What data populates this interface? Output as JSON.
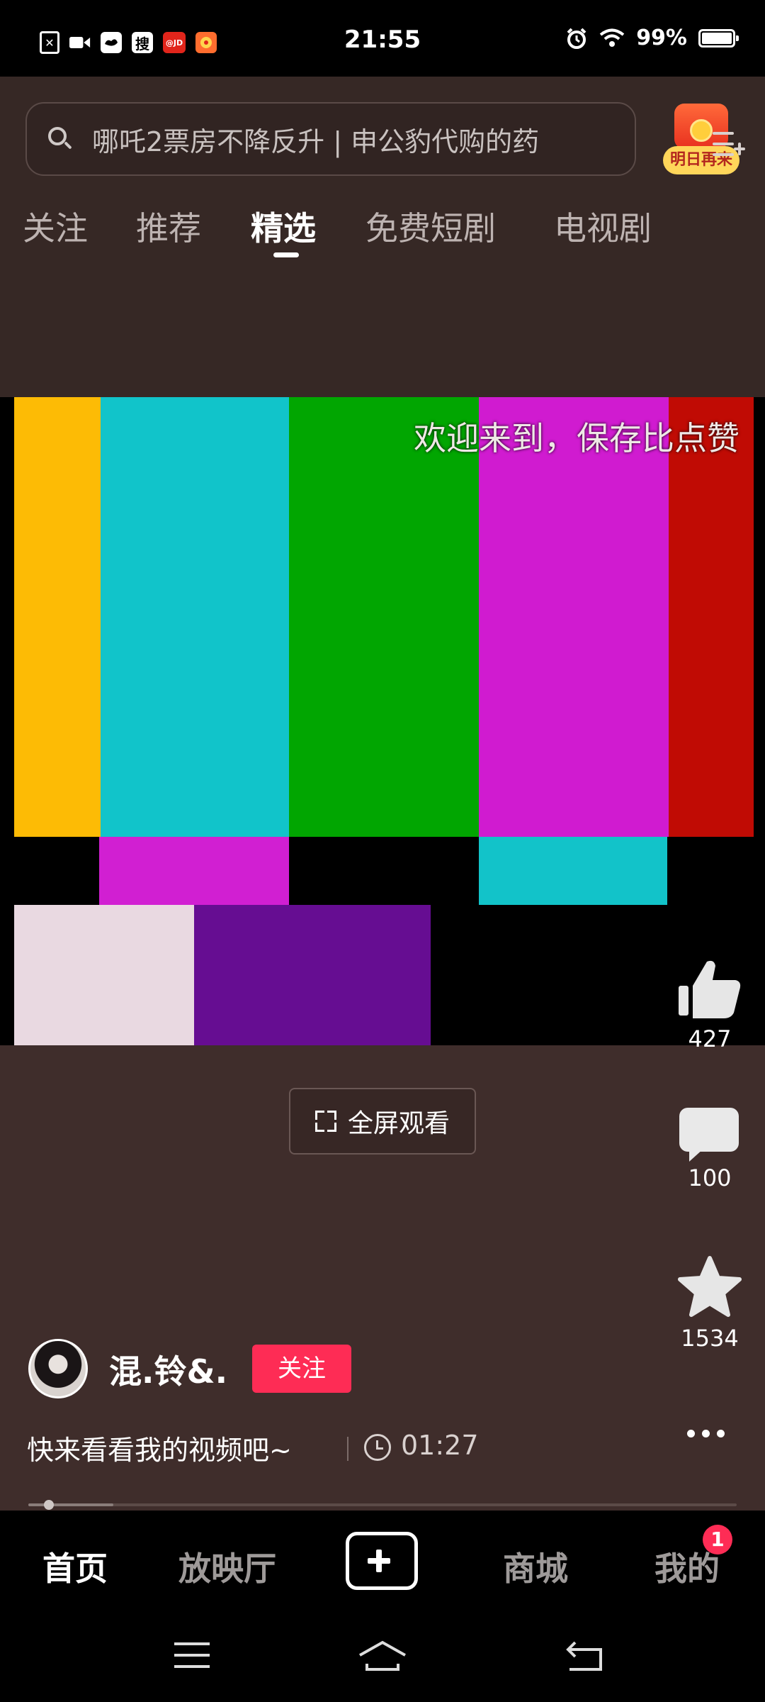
{
  "status_bar": {
    "time": "21:55",
    "battery": "99%",
    "left_icons": [
      "sim-off-icon",
      "video-record-icon",
      "weibo-icon",
      "sogou-icon",
      "jd-icon",
      "app-icon"
    ],
    "sogou_glyph": "搜",
    "jd_label": "@JD"
  },
  "search": {
    "placeholder": "哪吒2票房不降反升 | 申公豹代购的药"
  },
  "gift": {
    "label": "明日再来"
  },
  "tabs": [
    "关注",
    "推荐",
    "精选",
    "免费短剧",
    "电视剧"
  ],
  "active_tab": "精选",
  "video": {
    "overlay_text": "欢迎来到，保存比点赞"
  },
  "fullscreen": {
    "label": "全屏观看"
  },
  "actions": {
    "likes": "427",
    "comments": "100",
    "favorites": "1534"
  },
  "author": {
    "name": "混.铃&.",
    "follow_label": "关注"
  },
  "caption": "快来看看我的视频吧~",
  "duration": "01:27",
  "progress_fraction": 0.12,
  "bottom_nav": {
    "items": [
      "首页",
      "放映厅",
      "商城",
      "我的"
    ],
    "active": "首页",
    "badge": "1"
  },
  "colors": {
    "background": "#3f2d2b",
    "accent": "#fe2c55"
  }
}
